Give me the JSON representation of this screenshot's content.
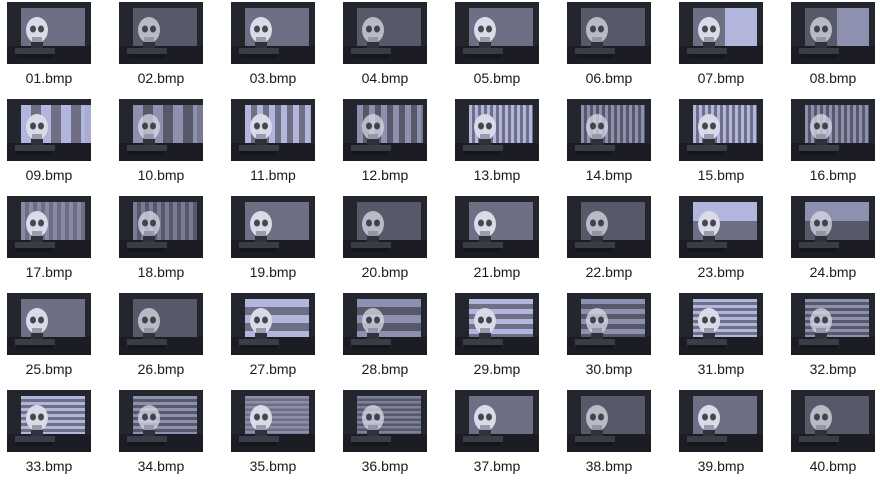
{
  "files": [
    {
      "name": "01.bmp",
      "pattern": "none",
      "lit": true
    },
    {
      "name": "02.bmp",
      "pattern": "none",
      "lit": false
    },
    {
      "name": "03.bmp",
      "pattern": "none",
      "lit": true
    },
    {
      "name": "04.bmp",
      "pattern": "none",
      "lit": false
    },
    {
      "name": "05.bmp",
      "pattern": "none",
      "lit": true
    },
    {
      "name": "06.bmp",
      "pattern": "none",
      "lit": false
    },
    {
      "name": "07.bmp",
      "pattern": "vstripe-half",
      "lit": true
    },
    {
      "name": "08.bmp",
      "pattern": "vstripe-half",
      "lit": false
    },
    {
      "name": "09.bmp",
      "pattern": "vstripe-wide",
      "lit": true
    },
    {
      "name": "10.bmp",
      "pattern": "vstripe-wide",
      "lit": false
    },
    {
      "name": "11.bmp",
      "pattern": "vstripe-med",
      "lit": true
    },
    {
      "name": "12.bmp",
      "pattern": "vstripe-med",
      "lit": false
    },
    {
      "name": "13.bmp",
      "pattern": "vstripe-fine",
      "lit": true
    },
    {
      "name": "14.bmp",
      "pattern": "vstripe-fine",
      "lit": false
    },
    {
      "name": "15.bmp",
      "pattern": "vstripe-fine",
      "lit": true
    },
    {
      "name": "16.bmp",
      "pattern": "vstripe-fine",
      "lit": false
    },
    {
      "name": "17.bmp",
      "pattern": "vstripe-faint",
      "lit": true
    },
    {
      "name": "18.bmp",
      "pattern": "vstripe-faint",
      "lit": false
    },
    {
      "name": "19.bmp",
      "pattern": "none",
      "lit": true
    },
    {
      "name": "20.bmp",
      "pattern": "none",
      "lit": false
    },
    {
      "name": "21.bmp",
      "pattern": "none",
      "lit": true
    },
    {
      "name": "22.bmp",
      "pattern": "none",
      "lit": false
    },
    {
      "name": "23.bmp",
      "pattern": "hstripe-half",
      "lit": true
    },
    {
      "name": "24.bmp",
      "pattern": "hstripe-half",
      "lit": false
    },
    {
      "name": "25.bmp",
      "pattern": "none",
      "lit": true
    },
    {
      "name": "26.bmp",
      "pattern": "none",
      "lit": false
    },
    {
      "name": "27.bmp",
      "pattern": "hstripe-wide",
      "lit": true
    },
    {
      "name": "28.bmp",
      "pattern": "hstripe-wide",
      "lit": false
    },
    {
      "name": "29.bmp",
      "pattern": "hstripe-med",
      "lit": true
    },
    {
      "name": "30.bmp",
      "pattern": "hstripe-med",
      "lit": false
    },
    {
      "name": "31.bmp",
      "pattern": "hstripe-fine",
      "lit": true
    },
    {
      "name": "32.bmp",
      "pattern": "hstripe-fine",
      "lit": false
    },
    {
      "name": "33.bmp",
      "pattern": "hstripe-fine",
      "lit": true
    },
    {
      "name": "34.bmp",
      "pattern": "hstripe-fine",
      "lit": false
    },
    {
      "name": "35.bmp",
      "pattern": "hstripe-faint",
      "lit": true
    },
    {
      "name": "36.bmp",
      "pattern": "hstripe-faint",
      "lit": false
    },
    {
      "name": "37.bmp",
      "pattern": "none",
      "lit": true
    },
    {
      "name": "38.bmp",
      "pattern": "none",
      "lit": false
    },
    {
      "name": "39.bmp",
      "pattern": "none",
      "lit": true
    },
    {
      "name": "40.bmp",
      "pattern": "none",
      "lit": false
    }
  ],
  "colors": {
    "background": "#ffffff",
    "thumb_bg": "#24262e",
    "screen": "#6e6f85",
    "stripe_light": "#b9bde6",
    "skull": "#d9dbe6",
    "label": "#1a1a1a"
  }
}
